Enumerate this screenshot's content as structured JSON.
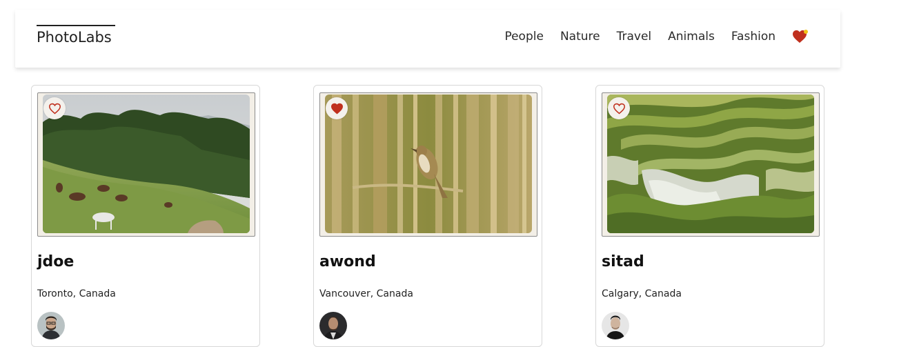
{
  "app": {
    "logo": "PhotoLabs"
  },
  "nav": {
    "items": [
      {
        "label": "People"
      },
      {
        "label": "Nature"
      },
      {
        "label": "Travel"
      },
      {
        "label": "Animals"
      },
      {
        "label": "Fashion"
      }
    ],
    "favorites_icon": "heart-icon",
    "favorites_has_notification": true
  },
  "colors": {
    "heart": "#c0301e",
    "notification_dot": "#f2c318",
    "like_button_bg": "#f4f1ec"
  },
  "photos": [
    {
      "username": "jdoe",
      "location": "Toronto, Canada",
      "liked": false,
      "image": "horses-grazing-hillside",
      "avatar": "user-avatar"
    },
    {
      "username": "awond",
      "location": "Vancouver, Canada",
      "liked": true,
      "image": "bird-in-reeds",
      "avatar": "user-avatar"
    },
    {
      "username": "sitad",
      "location": "Calgary, Canada",
      "liked": false,
      "image": "rice-terraces",
      "avatar": "user-avatar"
    }
  ]
}
